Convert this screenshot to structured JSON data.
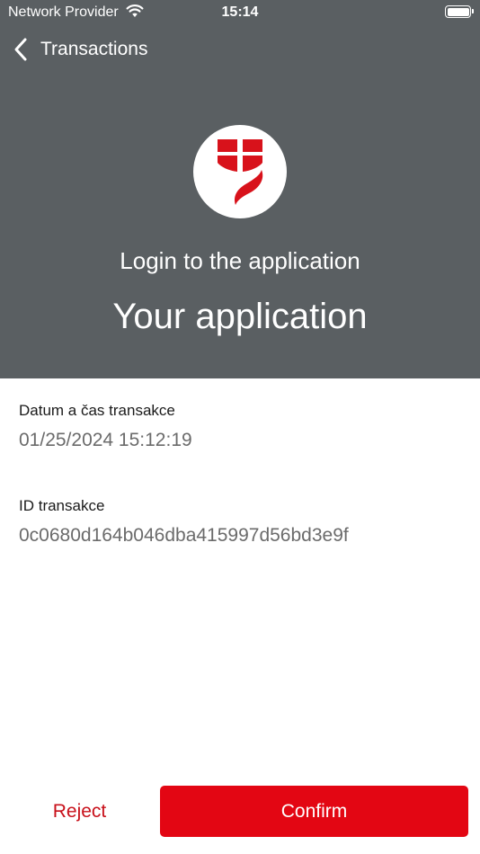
{
  "status_bar": {
    "carrier": "Network Provider",
    "time": "15:14",
    "wifi_icon": "wifi-icon",
    "battery_icon": "battery-icon"
  },
  "nav": {
    "back_icon": "chevron-left-icon",
    "back_label": "Transactions"
  },
  "header": {
    "logo_icon": "bank-logo-icon",
    "subtitle": "Login to the application",
    "title": "Your application"
  },
  "details": [
    {
      "label": "Datum a čas transakce",
      "value": "01/25/2024 15:12:19"
    },
    {
      "label": "ID transakce",
      "value": "0c0680d164b046dba415997d56bd3e9f"
    }
  ],
  "actions": {
    "reject_label": "Reject",
    "confirm_label": "Confirm"
  },
  "colors": {
    "header_bg": "#5a5f62",
    "accent": "#e30613",
    "reject_text": "#c8101a"
  }
}
